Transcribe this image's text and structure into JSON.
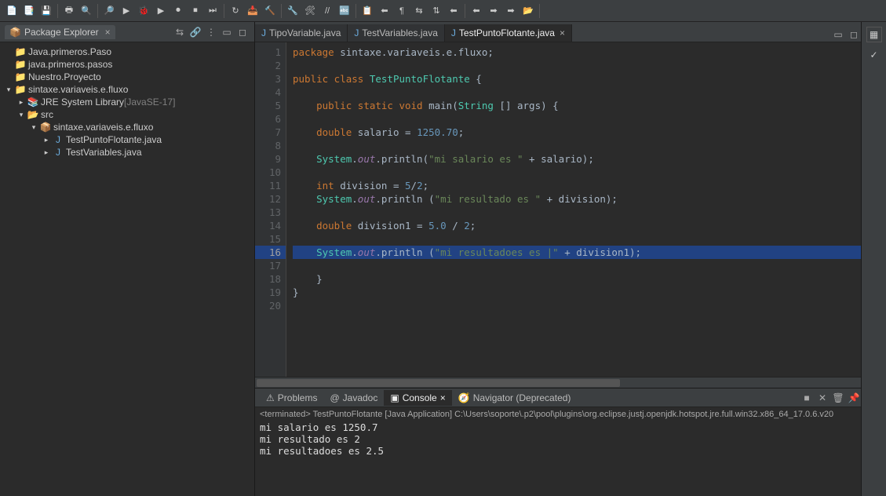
{
  "toolbar_icons": [
    "📄",
    "📑",
    "💾",
    "🖶",
    "🔍",
    "🔎",
    "▶",
    "🐞",
    "▶",
    "⏺",
    "⏹",
    "⏭",
    "↻",
    "📥",
    "🔨",
    "🔧",
    "🛠",
    "//",
    "🔤",
    "📋",
    "⬅",
    "¶",
    "⇆",
    "⇅",
    "⬅",
    "⬅",
    "➡",
    "➡",
    "📂"
  ],
  "package_explorer": {
    "title": "Package Explorer",
    "projects": [
      {
        "label": "Java.primeros.Paso",
        "indent": 0,
        "twisty": "",
        "icon": "📁"
      },
      {
        "label": "java.primeros.pasos",
        "indent": 0,
        "twisty": "",
        "icon": "📁"
      },
      {
        "label": "Nuestro.Proyecto",
        "indent": 0,
        "twisty": "",
        "icon": "📁"
      },
      {
        "label": "sintaxe.variaveis.e.fluxo",
        "indent": 0,
        "twisty": "▾",
        "icon": "📁"
      },
      {
        "label": "JRE System Library",
        "suffix": "[JavaSE-17]",
        "indent": 1,
        "twisty": "▸",
        "icon": "📚"
      },
      {
        "label": "src",
        "indent": 1,
        "twisty": "▾",
        "icon": "📂"
      },
      {
        "label": "sintaxe.variaveis.e.fluxo",
        "indent": 2,
        "twisty": "▾",
        "icon": "📦"
      },
      {
        "label": "TestPuntoFlotante.java",
        "indent": 3,
        "twisty": "▸",
        "icon": "J"
      },
      {
        "label": "TestVariables.java",
        "indent": 3,
        "twisty": "▸",
        "icon": "J"
      }
    ]
  },
  "editor_tabs": [
    {
      "label": "TipoVariable.java",
      "active": false
    },
    {
      "label": "TestVariables.java",
      "active": false
    },
    {
      "label": "TestPuntoFlotante.java",
      "active": true
    }
  ],
  "code_lines": [
    {
      "n": 1,
      "hl": false,
      "tokens": [
        [
          "kw",
          "package"
        ],
        [
          "id",
          " sintaxe.variaveis.e.fluxo;"
        ]
      ]
    },
    {
      "n": 2,
      "hl": false,
      "tokens": []
    },
    {
      "n": 3,
      "hl": false,
      "tokens": [
        [
          "kw",
          "public class "
        ],
        [
          "cls",
          "TestPuntoFlotante"
        ],
        [
          "id",
          " {"
        ]
      ]
    },
    {
      "n": 4,
      "hl": false,
      "tokens": []
    },
    {
      "n": 5,
      "hl": false,
      "tokens": [
        [
          "id",
          "    "
        ],
        [
          "kw",
          "public static void "
        ],
        [
          "mth",
          "main"
        ],
        [
          "id",
          "("
        ],
        [
          "cls",
          "String"
        ],
        [
          "id",
          " [] args) {"
        ]
      ]
    },
    {
      "n": 6,
      "hl": false,
      "tokens": []
    },
    {
      "n": 7,
      "hl": false,
      "tokens": [
        [
          "id",
          "    "
        ],
        [
          "kw",
          "double "
        ],
        [
          "id",
          "salario = "
        ],
        [
          "num",
          "1250.70"
        ],
        [
          "id",
          ";"
        ]
      ]
    },
    {
      "n": 8,
      "hl": false,
      "tokens": []
    },
    {
      "n": 9,
      "hl": false,
      "tokens": [
        [
          "id",
          "    "
        ],
        [
          "cls",
          "System"
        ],
        [
          "id",
          "."
        ],
        [
          "fld",
          "out"
        ],
        [
          "id",
          ".println("
        ],
        [
          "str",
          "\"mi salario es \""
        ],
        [
          "id",
          " + salario);"
        ]
      ]
    },
    {
      "n": 10,
      "hl": false,
      "tokens": []
    },
    {
      "n": 11,
      "hl": false,
      "tokens": [
        [
          "id",
          "    "
        ],
        [
          "kw",
          "int "
        ],
        [
          "id",
          "division = "
        ],
        [
          "num",
          "5"
        ],
        [
          "id",
          "/"
        ],
        [
          "num",
          "2"
        ],
        [
          "id",
          ";"
        ]
      ]
    },
    {
      "n": 12,
      "hl": false,
      "tokens": [
        [
          "id",
          "    "
        ],
        [
          "cls",
          "System"
        ],
        [
          "id",
          "."
        ],
        [
          "fld",
          "out"
        ],
        [
          "id",
          ".println ("
        ],
        [
          "str",
          "\"mi resultado es \""
        ],
        [
          "id",
          " + division);"
        ]
      ]
    },
    {
      "n": 13,
      "hl": false,
      "tokens": []
    },
    {
      "n": 14,
      "hl": false,
      "tokens": [
        [
          "id",
          "    "
        ],
        [
          "kw",
          "double "
        ],
        [
          "id",
          "division1 = "
        ],
        [
          "num",
          "5.0"
        ],
        [
          "id",
          " / "
        ],
        [
          "num",
          "2"
        ],
        [
          "id",
          ";"
        ]
      ]
    },
    {
      "n": 15,
      "hl": false,
      "tokens": []
    },
    {
      "n": 16,
      "hl": true,
      "tokens": [
        [
          "id",
          "    "
        ],
        [
          "cls",
          "System"
        ],
        [
          "id",
          "."
        ],
        [
          "fld",
          "out"
        ],
        [
          "id",
          ".println ("
        ],
        [
          "str",
          "\"mi resultadoes es |\""
        ],
        [
          "id",
          " + division1);"
        ]
      ]
    },
    {
      "n": 17,
      "hl": false,
      "tokens": []
    },
    {
      "n": 18,
      "hl": false,
      "tokens": [
        [
          "id",
          "    }"
        ]
      ]
    },
    {
      "n": 19,
      "hl": false,
      "tokens": [
        [
          "id",
          "}"
        ]
      ]
    },
    {
      "n": 20,
      "hl": false,
      "tokens": []
    }
  ],
  "bottom_tabs": [
    {
      "label": "Problems",
      "icon": "⚠",
      "active": false
    },
    {
      "label": "Javadoc",
      "icon": "@",
      "active": false
    },
    {
      "label": "Console",
      "icon": "▣",
      "active": true,
      "closable": true
    },
    {
      "label": "Navigator (Deprecated)",
      "icon": "🧭",
      "active": false
    }
  ],
  "console": {
    "header": "<terminated> TestPuntoFlotante [Java Application] C:\\Users\\soporte\\.p2\\pool\\plugins\\org.eclipse.justj.openjdk.hotspot.jre.full.win32.x86_64_17.0.6.v20",
    "lines": [
      "mi salario es 1250.7",
      "mi resultado es 2",
      "mi resultadoes es 2.5"
    ]
  }
}
